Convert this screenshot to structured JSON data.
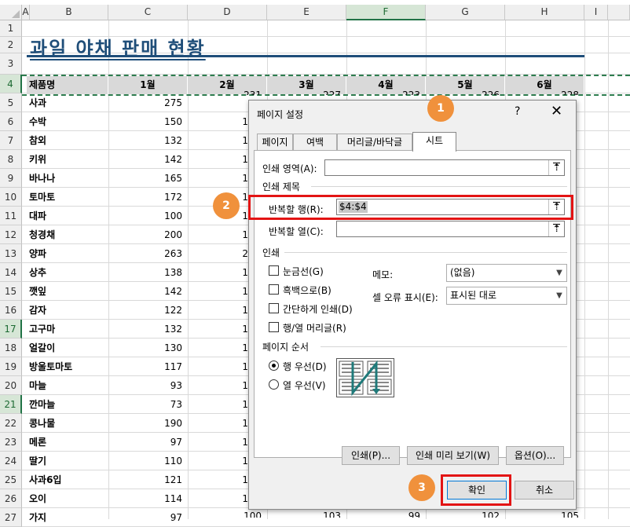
{
  "sheet": {
    "columns": [
      "A",
      "B",
      "C",
      "D",
      "E",
      "F",
      "G",
      "H",
      "I"
    ],
    "selected_column": "F",
    "row_numbers": [
      "1",
      "2",
      "3",
      "4",
      "5",
      "6",
      "7",
      "8",
      "9",
      "10",
      "11",
      "12",
      "13",
      "14",
      "15",
      "16",
      "17",
      "18",
      "19",
      "20",
      "21",
      "22",
      "23",
      "24",
      "25",
      "26",
      "27"
    ],
    "selected_rows": [
      "4",
      "17",
      "21"
    ],
    "title": "과일 야채 판매 현황",
    "header": [
      "제품명",
      "1월",
      "2월",
      "3월",
      "4월",
      "5월",
      "6월"
    ],
    "products": [
      "사과",
      "수박",
      "참외",
      "키위",
      "바나나",
      "토마토",
      "대파",
      "청경채",
      "양파",
      "상추",
      "깻잎",
      "감자",
      "고구마",
      "얼갈이",
      "방울토마토",
      "마늘",
      "깐마늘",
      "콩나물",
      "메론",
      "딸기",
      "사과6입",
      "오이",
      "가지"
    ],
    "jan_values": [
      "275",
      "150",
      "132",
      "142",
      "165",
      "172",
      "100",
      "200",
      "263",
      "138",
      "142",
      "122",
      "132",
      "130",
      "117",
      "93",
      "73",
      "190",
      "97",
      "110",
      "121",
      "114",
      "97"
    ],
    "row5_partial": [
      "231",
      "227",
      "223",
      "226",
      "228"
    ],
    "row27_partial": [
      "100",
      "103",
      "99",
      "102",
      "105"
    ],
    "col_d_fragments": [
      "1",
      "1",
      "1",
      "1",
      "1",
      "1",
      "1",
      "2",
      "1",
      "1",
      "1",
      "1",
      "1",
      "1",
      "1",
      "1",
      "1",
      "1",
      "1",
      "1",
      "1"
    ]
  },
  "dialog": {
    "title": "페이지 설정",
    "help": "?",
    "close": "✕",
    "tabs": [
      "페이지",
      "여백",
      "머리글/바닥글",
      "시트"
    ],
    "print_area_label": "인쇄 영역(A):",
    "print_area_value": "",
    "print_titles_label": "인쇄 제목",
    "rows_to_repeat_label": "반복할 행(R):",
    "rows_to_repeat_value": "$4:$4",
    "cols_to_repeat_label": "반복할 열(C):",
    "cols_to_repeat_value": "",
    "print_section_label": "인쇄",
    "checkboxes": [
      "눈금선(G)",
      "흑백으로(B)",
      "간단하게 인쇄(D)",
      "행/열 머리글(R)"
    ],
    "comments_label": "메모:",
    "comments_value": "(없음)",
    "cell_errors_label": "셀 오류 표시(E):",
    "cell_errors_value": "표시된 대로",
    "page_order_label": "페이지 순서",
    "radio_down_then_over": "행 우선(D)",
    "radio_over_then_down": "열 우선(V)",
    "print_button": "인쇄(P)...",
    "preview_button": "인쇄 미리 보기(W)",
    "options_button": "옵션(O)...",
    "ok_button": "확인",
    "cancel_button": "취소"
  },
  "callouts": [
    "1",
    "2",
    "3"
  ],
  "colors": {
    "title": "#1f4e79",
    "highlight_red": "#e31414",
    "badge": "#f0913c",
    "excel_green": "#217346"
  }
}
